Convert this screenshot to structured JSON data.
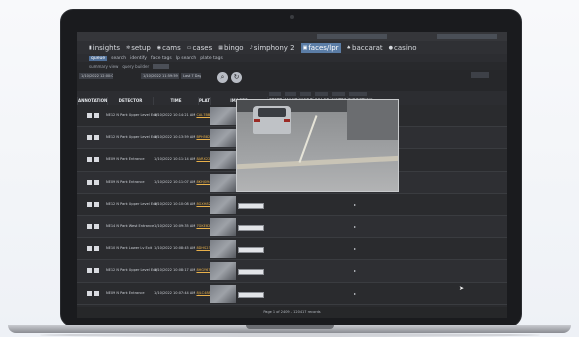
{
  "nav": {
    "items": [
      {
        "label": "insights",
        "icon": "bars-icon"
      },
      {
        "label": "setup",
        "icon": "gear-icon"
      },
      {
        "label": "cams",
        "icon": "camera-icon"
      },
      {
        "label": "cases",
        "icon": "folder-icon"
      },
      {
        "label": "bingo",
        "icon": "bingo-icon"
      },
      {
        "label": "simphony 2",
        "icon": "simphony-icon"
      },
      {
        "label": "faces/lpr",
        "icon": "faces-icon",
        "active": true
      },
      {
        "label": "baccarat",
        "icon": "cards-icon"
      },
      {
        "label": "casino",
        "icon": "chips-icon"
      }
    ]
  },
  "subnav": {
    "items": [
      {
        "label": "queue",
        "active": true
      },
      {
        "label": "search"
      },
      {
        "label": "identify"
      },
      {
        "label": "face tags"
      },
      {
        "label": "lp search"
      },
      {
        "label": "plate tags"
      }
    ]
  },
  "toolbar": {
    "summary_view": "summary view",
    "query_builder": "query builder"
  },
  "filters": {
    "start_time": "1/10/2022 12:00:00 AM",
    "end_time": "1/10/2022 11:59:59 PM",
    "range_label": "Last 7 Days"
  },
  "columns": [
    "ANNOTATIONS",
    "DETECTOR",
    "TIME",
    "PLATE",
    "IMAGES",
    "STATE",
    "MAKE",
    "MODEL",
    "COLOR",
    "NOTES",
    "DIRECTION"
  ],
  "rows": [
    {
      "detector": "NE12 N Park Upper Level Exit",
      "time": "1/10/2022 10:14:21 AM",
      "plate": "CAL7BBB"
    },
    {
      "detector": "NE12 N Park Upper Level Exit",
      "time": "1/10/2022 10:13:59 AM",
      "plate": "BPH5821"
    },
    {
      "detector": "NE09 N Park Entrance",
      "time": "1/10/2022 10:11:14 AM",
      "plate": "8ARX227"
    },
    {
      "detector": "NE09 N Park Entrance",
      "time": "1/10/2022 10:11:07 AM",
      "plate": "8KHJ094"
    },
    {
      "detector": "NE12 N Park Upper Level Exit",
      "time": "1/10/2022 10:10:08 AM",
      "plate": "8GXH823"
    },
    {
      "detector": "NE14 N Park West Entrance",
      "time": "1/10/2022 10:09:35 AM",
      "plate": "7GKE821"
    },
    {
      "detector": "NE10 N Park Lower Lv Exit",
      "time": "1/10/2022 10:08:45 AM",
      "plate": "8DHS230"
    },
    {
      "detector": "NE12 N Park Upper Level Exit",
      "time": "1/10/2022 10:08:17 AM",
      "plate": "8HGY672"
    },
    {
      "detector": "NE09 N Park Entrance",
      "time": "1/10/2022 10:07:44 AM",
      "plate": "8JLC488"
    }
  ],
  "pager": {
    "text": "Page 1 of 2409 - 120417 records"
  }
}
